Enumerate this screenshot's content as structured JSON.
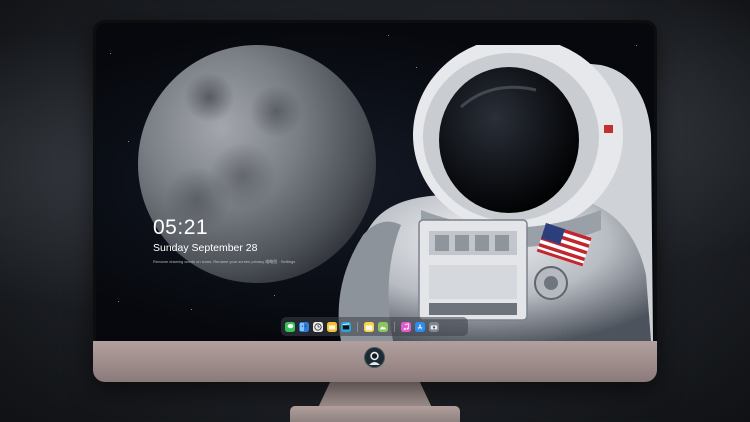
{
  "lockscreen": {
    "time": "05:21",
    "date": "Sunday September  28",
    "tip": "Rename drawing words on icons. Rename your screen privacy 缩略图 · Settings"
  },
  "dock": {
    "apps": [
      {
        "name": "messages",
        "icon": "messages-icon",
        "color": "#3cc15a"
      },
      {
        "name": "finder",
        "icon": "finder-icon",
        "color": "#2f7bd8"
      },
      {
        "name": "clock",
        "icon": "clock-icon",
        "color": "#e9e9ec"
      },
      {
        "name": "file-manager",
        "icon": "folder-icon",
        "color": "#f1c037"
      },
      {
        "name": "video",
        "icon": "clapperboard-icon",
        "color": "#2ba6e0"
      },
      {
        "name": "notes",
        "icon": "notes-icon",
        "color": "#f7d44c"
      },
      {
        "name": "photos",
        "icon": "photos-icon",
        "color": "#8ac65a"
      },
      {
        "name": "itunes",
        "icon": "music-icon",
        "color": "#e45bd0"
      },
      {
        "name": "app-store",
        "icon": "app-store-icon",
        "color": "#2d8cf0"
      },
      {
        "name": "camera",
        "icon": "camera-icon",
        "color": "#7f858e"
      }
    ]
  },
  "colors": {
    "screen_bg": "#06080d",
    "bezel": "#0c0d0f",
    "chin": "#a89695",
    "dock": "#3c4048"
  }
}
